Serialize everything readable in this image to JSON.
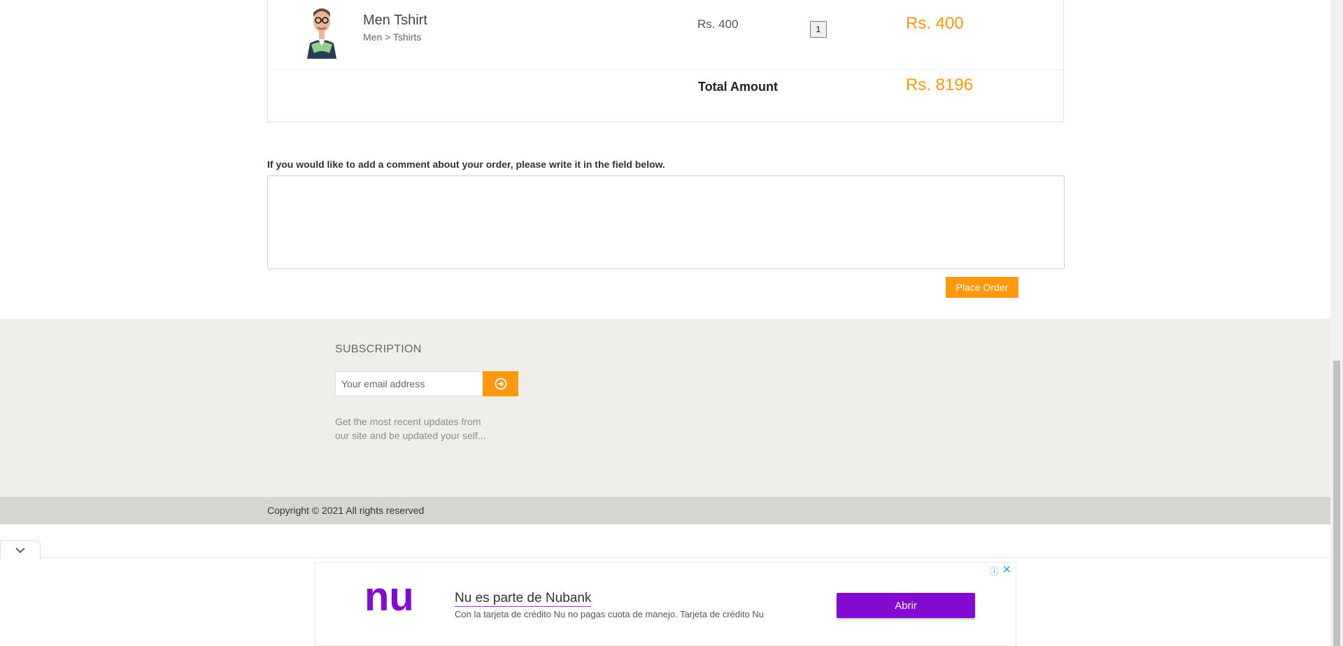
{
  "cart": {
    "item": {
      "name": "Men Tshirt",
      "category": "Men > Tshirts",
      "price": "Rs. 400",
      "quantity": "1",
      "line_total": "Rs. 400"
    },
    "total_label": "Total Amount",
    "total_value": "Rs. 8196"
  },
  "comment": {
    "label": "If you would like to add a comment about your order, please write it in the field below.",
    "value": ""
  },
  "place_order_label": "Place Order",
  "footer": {
    "subscription_title": "SUBSCRIPTION",
    "email_placeholder": "Your email address",
    "desc_line1": "Get the most recent updates from",
    "desc_line2": "our site and be updated your self...",
    "copyright": "Copyright © 2021 All rights reserved"
  },
  "ad": {
    "brand": "nu",
    "title": "Nu es parte de Nubank",
    "description": "Con la tarjeta de crédito Nu no pagas cuota de manejo. Tarjeta de crédito Nu",
    "cta": "Abrir",
    "info_glyph": "ⓘ",
    "close_glyph": "✕"
  },
  "colors": {
    "accent_orange": "#fe980f",
    "nubank_purple": "#820ad1",
    "footer_bg": "#efeee8"
  },
  "icons": {
    "subscribe": "arrow-circle-right-icon",
    "collapse": "chevron-down-icon"
  }
}
